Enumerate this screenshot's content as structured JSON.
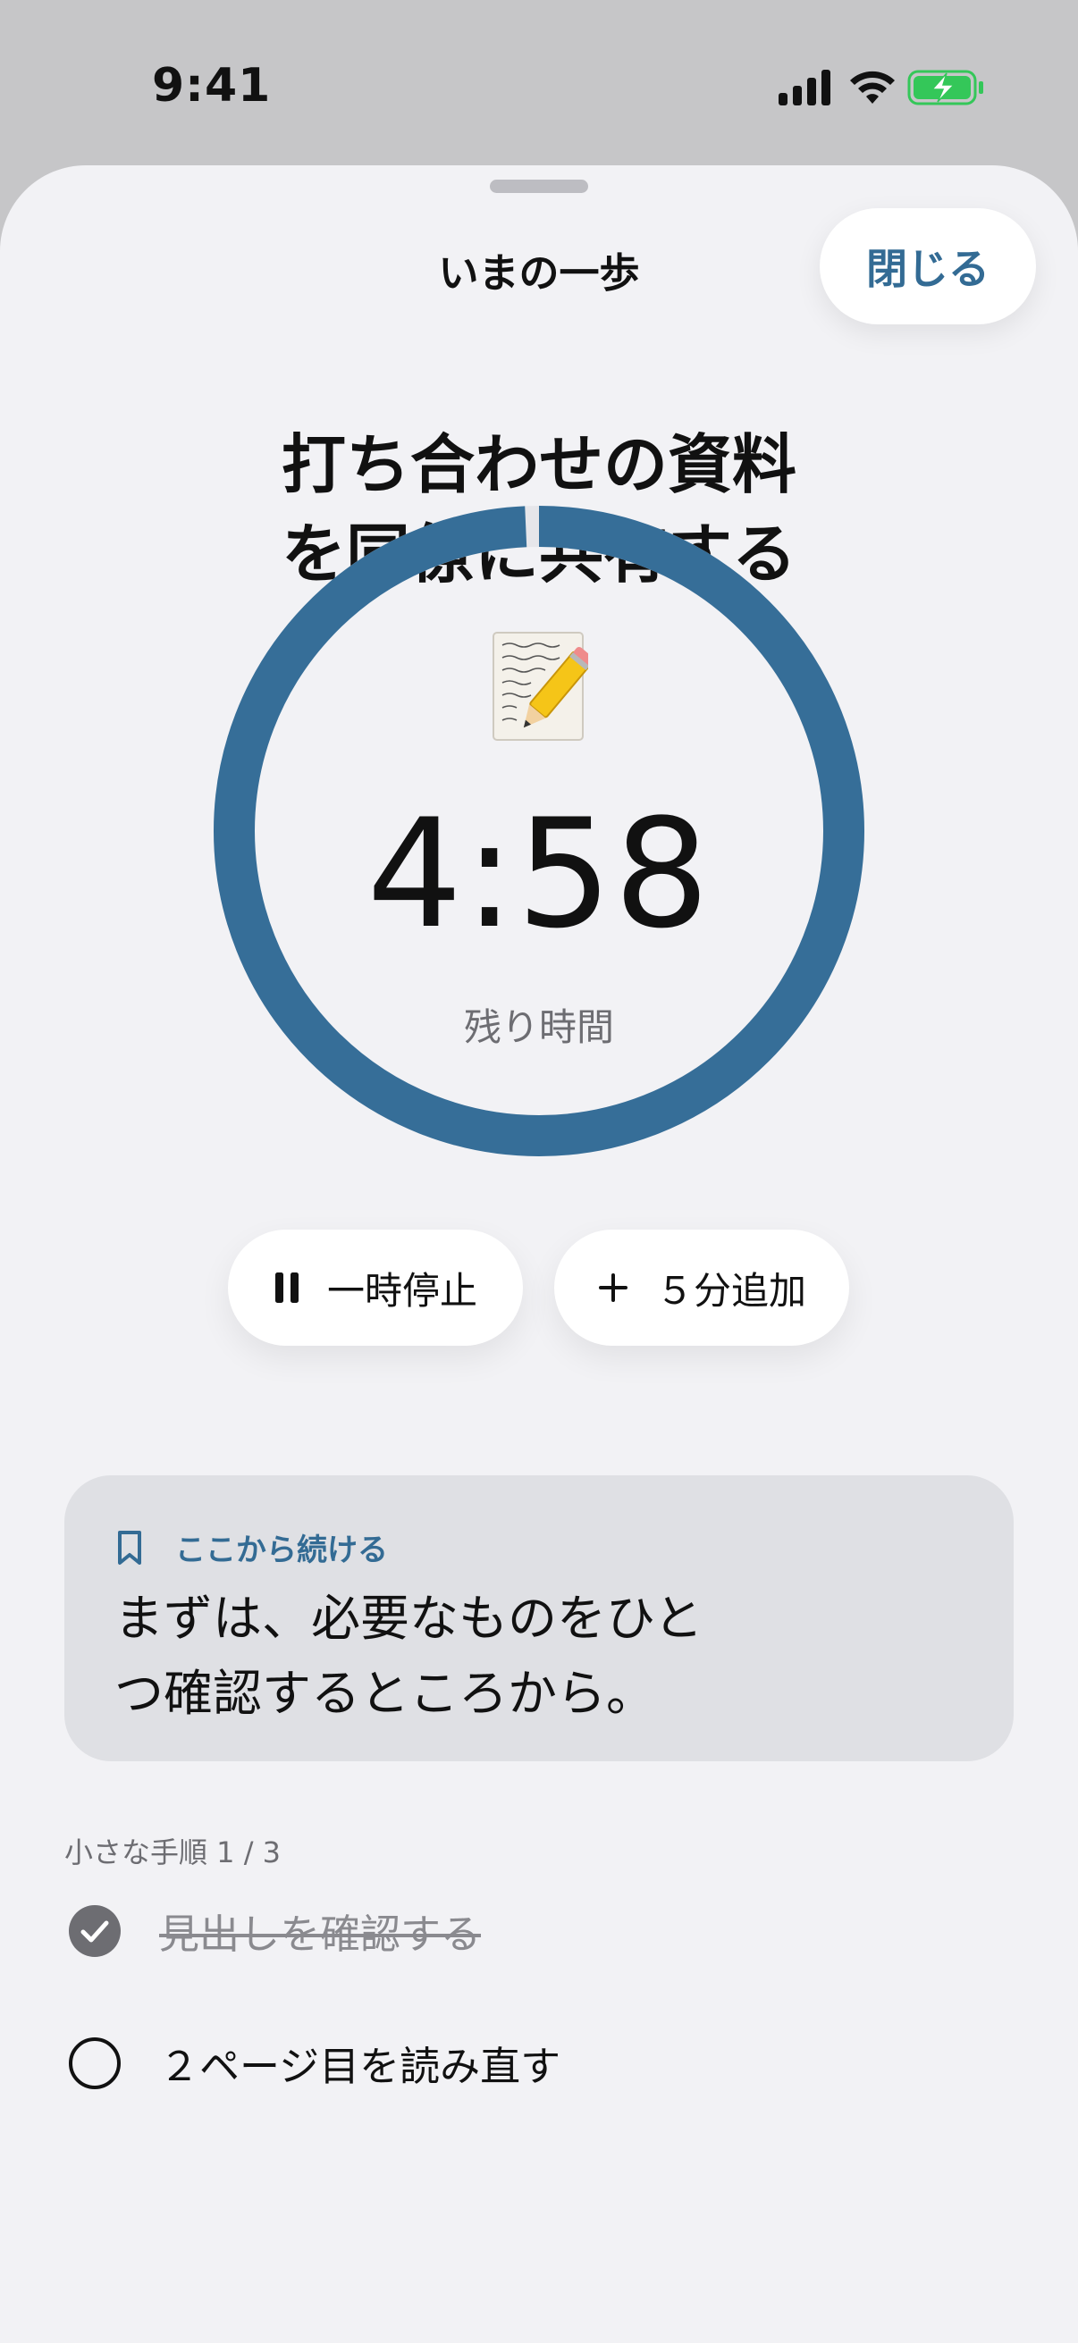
{
  "status_bar": {
    "time": "9:41"
  },
  "sheet": {
    "title": "いまの一歩",
    "close_label": "閉じる"
  },
  "task": {
    "title_line1": "打ち合わせの資料",
    "title_line2": "を同僚に共有する"
  },
  "timer": {
    "emoji": "memo-pencil-icon",
    "value": "4:58",
    "caption": "残り時間",
    "progress": 0.993,
    "ring_color": "#366e98"
  },
  "controls": {
    "pause_label": "一時停止",
    "add_label": "５分追加"
  },
  "resume_card": {
    "label": "ここから続ける",
    "text_line1": "まずは、必要なものをひと",
    "text_line2": "つ確認するところから。"
  },
  "steps": {
    "header": "小さな手順  1 / 3",
    "items": [
      {
        "label": "見出しを確認する",
        "done": true
      },
      {
        "label": "２ページ目を読み直す",
        "done": false
      }
    ]
  },
  "colors": {
    "accent": "#336b94",
    "background": "#f2f2f5",
    "card": "#dfe0e4"
  }
}
